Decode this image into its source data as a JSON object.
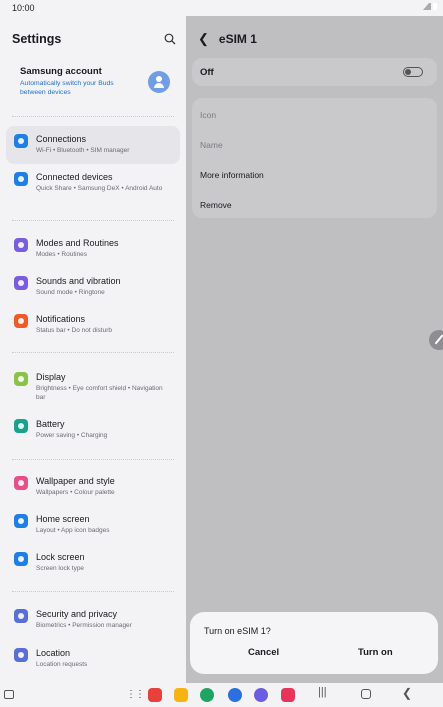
{
  "status": {
    "time": "10:00"
  },
  "left": {
    "title": "Settings",
    "account": {
      "name": "Samsung account",
      "subtitle": "Automatically switch your Buds between devices"
    },
    "items": [
      {
        "title": "Connections",
        "subtitle": "Wi-Fi • Bluetooth • SIM manager",
        "color": "#1f7fe6",
        "icon": "wifi-icon"
      },
      {
        "title": "Connected devices",
        "subtitle": "Quick Share • Samsung DeX • Android Auto",
        "color": "#1f7fe6",
        "icon": "devices-icon"
      },
      {
        "title": "Modes and Routines",
        "subtitle": "Modes • Routines",
        "color": "#7b5ce0",
        "icon": "routines-icon"
      },
      {
        "title": "Sounds and vibration",
        "subtitle": "Sound mode • Ringtone",
        "color": "#7b5ce0",
        "icon": "sound-icon"
      },
      {
        "title": "Notifications",
        "subtitle": "Status bar • Do not disturb",
        "color": "#f05a28",
        "icon": "notifications-icon"
      },
      {
        "title": "Display",
        "subtitle": "Brightness • Eye comfort shield • Navigation bar",
        "color": "#8bc34a",
        "icon": "display-icon"
      },
      {
        "title": "Battery",
        "subtitle": "Power saving • Charging",
        "color": "#1aa38c",
        "icon": "battery-icon"
      },
      {
        "title": "Wallpaper and style",
        "subtitle": "Wallpapers • Colour palette",
        "color": "#e94e8a",
        "icon": "wallpaper-icon"
      },
      {
        "title": "Home screen",
        "subtitle": "Layout • App icon badges",
        "color": "#1f7fe6",
        "icon": "home-screen-icon"
      },
      {
        "title": "Lock screen",
        "subtitle": "Screen lock type",
        "color": "#1f7fe6",
        "icon": "lock-icon"
      },
      {
        "title": "Security and privacy",
        "subtitle": "Biometrics • Permission manager",
        "color": "#5a6fd6",
        "icon": "shield-icon"
      },
      {
        "title": "Location",
        "subtitle": "Location requests",
        "color": "#5a6fd6",
        "icon": "location-icon"
      }
    ]
  },
  "right": {
    "title": "eSIM 1",
    "toggle_label": "Off",
    "rows": [
      "Icon",
      "Name",
      "More information",
      "Remove"
    ],
    "dialog": {
      "question": "Turn on eSIM 1?",
      "cancel": "Cancel",
      "confirm": "Turn on"
    }
  },
  "dock": [
    {
      "name": "app-red-icon",
      "color": "#e8403a"
    },
    {
      "name": "app-folder-icon",
      "color": "#f6b312"
    },
    {
      "name": "app-phone-icon",
      "color": "#1fa463"
    },
    {
      "name": "app-messages-icon",
      "color": "#2b6fe0"
    },
    {
      "name": "app-internet-icon",
      "color": "#6b5ce0"
    },
    {
      "name": "app-camera-icon",
      "color": "#e8335a"
    }
  ]
}
